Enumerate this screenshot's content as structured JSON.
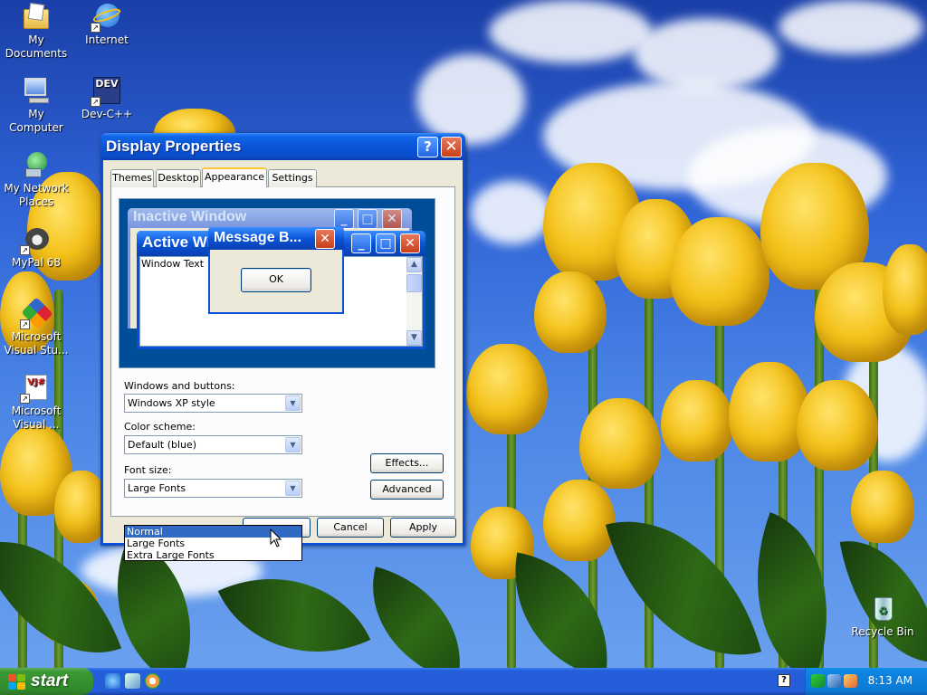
{
  "desktop": {
    "icons": [
      {
        "label": "My Documents",
        "icon": "folder-documents-icon"
      },
      {
        "label": "Internet",
        "icon": "internet-explorer-icon"
      },
      {
        "label": "My Computer",
        "icon": "computer-icon"
      },
      {
        "label": "Dev-C++",
        "icon": "devcpp-icon"
      },
      {
        "label": "My Network Places",
        "icon": "network-places-icon"
      },
      {
        "label": "MyPal 68",
        "icon": "mypal-raccoon-icon"
      },
      {
        "label": "Microsoft Visual Stu...",
        "icon": "visual-studio-icon"
      },
      {
        "label": "Microsoft Visual ...",
        "icon": "visual-jsharp-icon"
      },
      {
        "label": "Recycle Bin",
        "icon": "recycle-bin-icon"
      }
    ],
    "dev_badge": "DEV",
    "vj_badge": "VJ#"
  },
  "window": {
    "title": "Display Properties",
    "help_glyph": "?",
    "close_glyph": "✕",
    "tabs": [
      {
        "label": "Themes",
        "active": false
      },
      {
        "label": "Desktop",
        "active": false
      },
      {
        "label": "Appearance",
        "active": true
      },
      {
        "label": "Settings",
        "active": false
      }
    ],
    "preview": {
      "inactive_title": "Inactive Window",
      "active_title": "Active Window",
      "window_text": "Window Text",
      "message_title": "Message B...",
      "ok_label": "OK"
    },
    "windows_buttons_label": "Windows and buttons:",
    "windows_buttons_value": "Windows XP style",
    "color_scheme_label": "Color scheme:",
    "color_scheme_value": "Default (blue)",
    "font_size_label": "Font size:",
    "font_size_value": "Large Fonts",
    "font_size_options": [
      "Normal",
      "Large Fonts",
      "Extra Large Fonts"
    ],
    "font_size_highlighted": "Normal",
    "effects_label": "Effects...",
    "advanced_label": "Advanced",
    "cancel_label": "Cancel",
    "apply_label": "Apply"
  },
  "taskbar": {
    "start_label": "start",
    "clock": "8:13 AM",
    "help_glyph": "?"
  },
  "colors": {
    "xp_blue": "#0a4fd6",
    "start_green": "#3c9a35",
    "selection": "#316ac5"
  }
}
